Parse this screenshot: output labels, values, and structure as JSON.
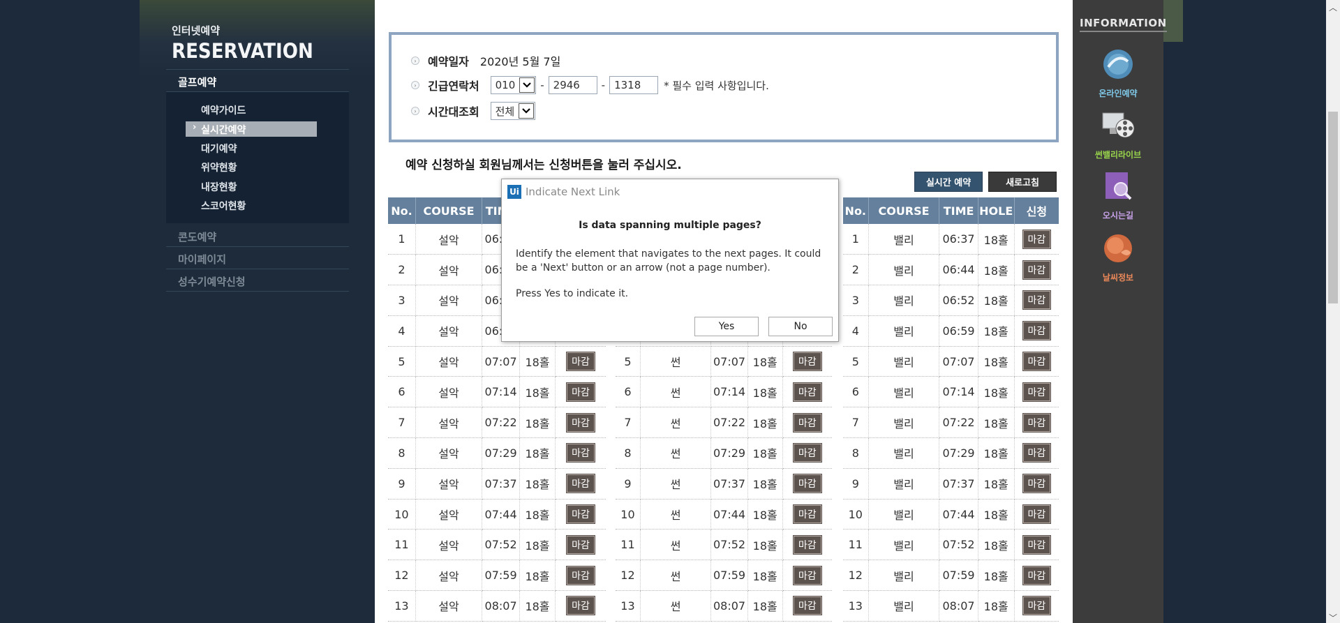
{
  "left_nav": {
    "brand_small": "인터넷예약",
    "brand_big": "RESERVATION",
    "golf": "골프예약",
    "sub_items": [
      "예약가이드",
      "실시간예약",
      "대기예약",
      "위약현황",
      "내장현황",
      "스코어현황"
    ],
    "condo": "콘도예약",
    "mypage": "마이페이지",
    "peak": "성수기예약신청"
  },
  "form": {
    "date_label": "예약일자",
    "date_value": "2020년 5월 7일",
    "phone_label": "긴급연락처",
    "phone_prefix": "010",
    "phone_mid": "2946",
    "phone_last": "1318",
    "dash": "-",
    "required_note": "* 필수 입력 사항입니다.",
    "time_label": "시간대조회",
    "time_value": "전체"
  },
  "notice": "예약 신청하실 회원님께서는 신청버튼을 눌러 주십시오.",
  "buttons": {
    "realtime": "실시간 예약",
    "refresh": "새로고침"
  },
  "table_headers": [
    "No.",
    "COURSE",
    "TIME",
    "HOLE",
    "신청"
  ],
  "courses": [
    "설악",
    "썬",
    "밸리"
  ],
  "hole": "18홀",
  "status": "마감",
  "rows": [
    {
      "no": "1",
      "time": "06:37"
    },
    {
      "no": "2",
      "time": "06:44"
    },
    {
      "no": "3",
      "time": "06:52"
    },
    {
      "no": "4",
      "time": "06:59"
    },
    {
      "no": "5",
      "time": "07:07"
    },
    {
      "no": "6",
      "time": "07:14"
    },
    {
      "no": "7",
      "time": "07:22"
    },
    {
      "no": "8",
      "time": "07:29"
    },
    {
      "no": "9",
      "time": "07:37"
    },
    {
      "no": "10",
      "time": "07:44"
    },
    {
      "no": "11",
      "time": "07:52"
    },
    {
      "no": "12",
      "time": "07:59"
    },
    {
      "no": "13",
      "time": "08:07"
    }
  ],
  "info": {
    "title": "INFORMATION",
    "items": [
      {
        "label": "온라인예약",
        "color": "#7fc8e8"
      },
      {
        "label": "썬밸리라이브",
        "color": "#9ad64b"
      },
      {
        "label": "오시는길",
        "color": "#c8a2e8"
      },
      {
        "label": "날씨정보",
        "color": "#ee8a5a"
      }
    ]
  },
  "dialog": {
    "logo": "Ui",
    "title": "Indicate Next Link",
    "question": "Is data spanning multiple pages?",
    "message": "Identify the element that navigates to the next pages. It could be a 'Next' button or an arrow (not a page number).",
    "instruction": "Press Yes to indicate it.",
    "yes": "Yes",
    "no": "No"
  }
}
